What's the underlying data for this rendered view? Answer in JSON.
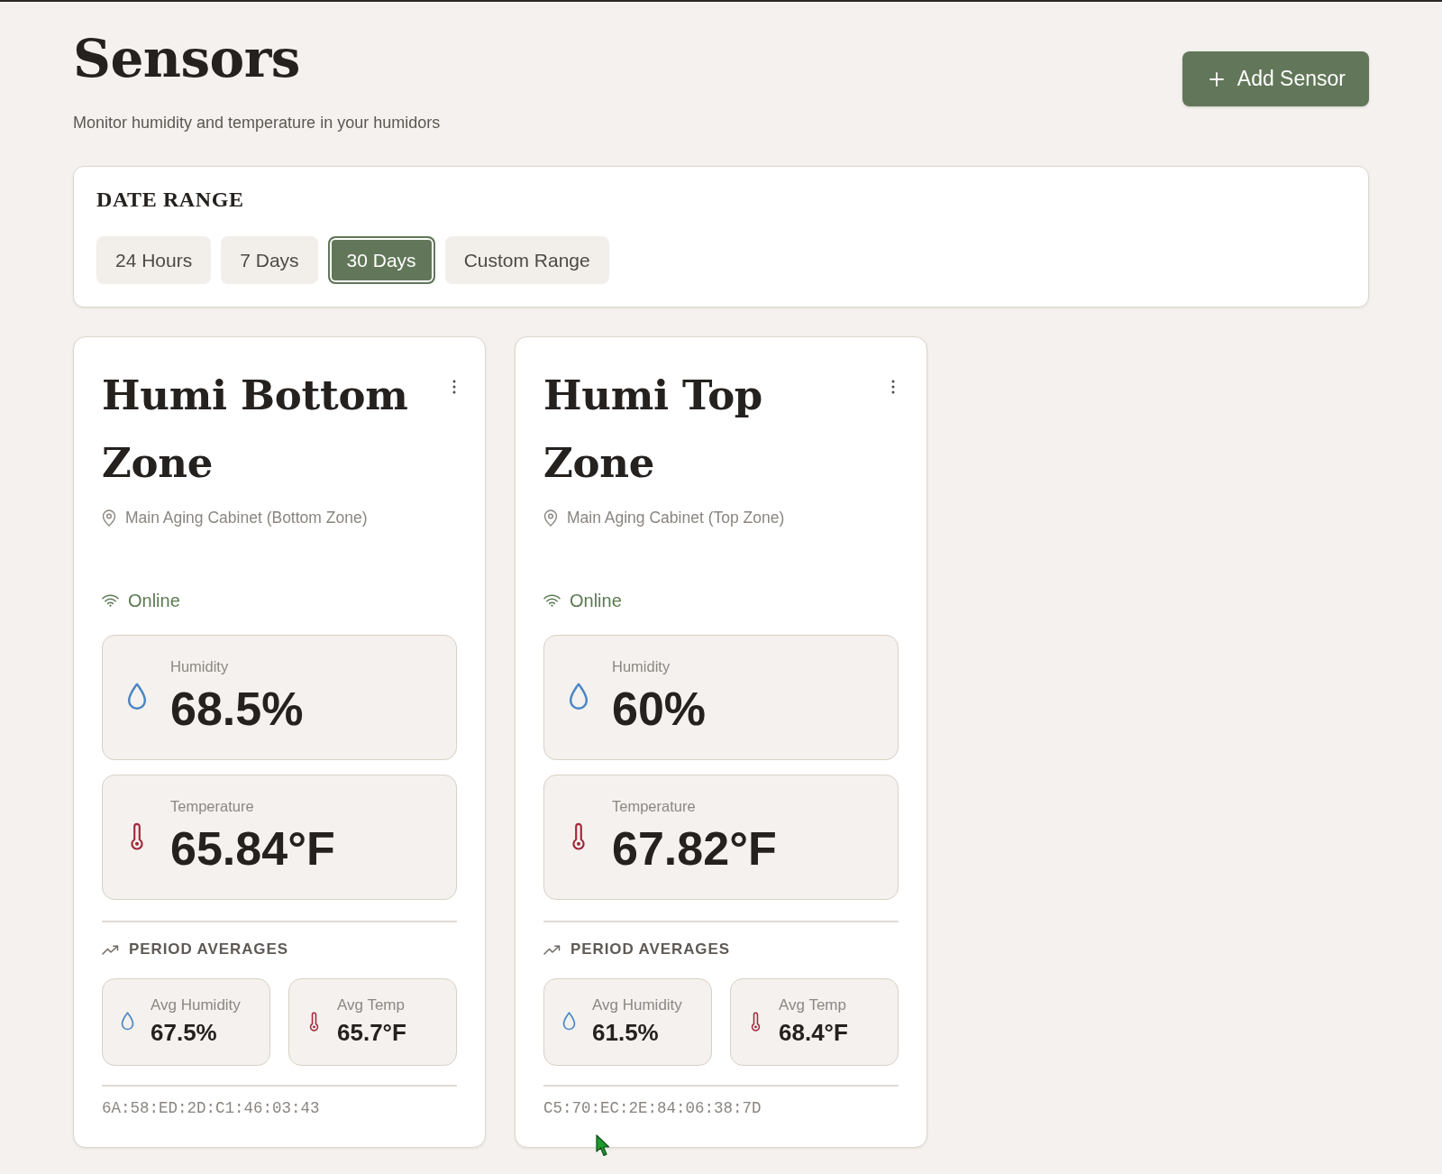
{
  "header": {
    "title": "Sensors",
    "subtitle": "Monitor humidity and temperature in your humidors",
    "add_button": "Add Sensor"
  },
  "date_range": {
    "title": "DATE RANGE",
    "options": [
      {
        "label": "24 Hours",
        "selected": false
      },
      {
        "label": "7 Days",
        "selected": false
      },
      {
        "label": "30 Days",
        "selected": true
      },
      {
        "label": "Custom Range",
        "selected": false
      }
    ]
  },
  "sensors": [
    {
      "name": "Humi Bottom Zone",
      "location": "Main Aging Cabinet (Bottom Zone)",
      "status": "Online",
      "online": true,
      "readings": [
        {
          "kind": "humidity",
          "label": "Humidity",
          "value": "68.5%"
        },
        {
          "kind": "temperature",
          "label": "Temperature",
          "value": "65.84°F"
        }
      ],
      "averages_title": "PERIOD AVERAGES",
      "averages": [
        {
          "kind": "humidity",
          "label": "Avg Humidity",
          "value": "67.5%"
        },
        {
          "kind": "temperature",
          "label": "Avg Temp",
          "value": "65.7°F"
        }
      ],
      "mac": "6A:58:ED:2D:C1:46:03:43"
    },
    {
      "name": "Humi Top Zone",
      "location": "Main Aging Cabinet (Top Zone)",
      "status": "Online",
      "online": true,
      "readings": [
        {
          "kind": "humidity",
          "label": "Humidity",
          "value": "60%"
        },
        {
          "kind": "temperature",
          "label": "Temperature",
          "value": "67.82°F"
        }
      ],
      "averages_title": "PERIOD AVERAGES",
      "averages": [
        {
          "kind": "humidity",
          "label": "Avg Humidity",
          "value": "61.5%"
        },
        {
          "kind": "temperature",
          "label": "Avg Temp",
          "value": "68.4°F"
        }
      ],
      "mac": "C5:70:EC:2E:84:06:38:7D"
    }
  ]
}
